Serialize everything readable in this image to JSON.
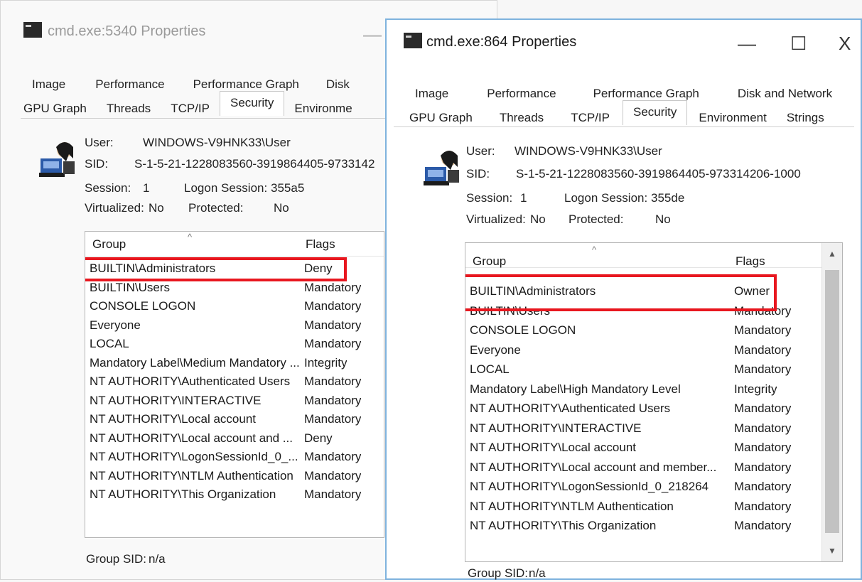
{
  "back_window": {
    "title": "cmd.exe:5340 Properties",
    "tabs_row1": [
      "Image",
      "Performance",
      "Performance Graph",
      "Disk"
    ],
    "tabs_row2": [
      "GPU Graph",
      "Threads",
      "TCP/IP",
      "Security",
      "Environme"
    ],
    "user_label": "User:",
    "user_value": "WINDOWS-V9HNK33\\User",
    "sid_label": "SID:",
    "sid_value": "S-1-5-21-1228083560-3919864405-9733142",
    "session_label": "Session:",
    "session_value": "1",
    "logon_label": "Logon Session:",
    "logon_value": "355a5",
    "virtualized_label": "Virtualized:",
    "virtualized_value": "No",
    "protected_label": "Protected:",
    "protected_value": "No",
    "list_headers": {
      "group": "Group",
      "flags": "Flags"
    },
    "rows": [
      {
        "group": "BUILTIN\\Administrators",
        "flags": "Deny"
      },
      {
        "group": "BUILTIN\\Users",
        "flags": "Mandatory"
      },
      {
        "group": "CONSOLE LOGON",
        "flags": "Mandatory"
      },
      {
        "group": "Everyone",
        "flags": "Mandatory"
      },
      {
        "group": "LOCAL",
        "flags": "Mandatory"
      },
      {
        "group": "Mandatory Label\\Medium Mandatory ...",
        "flags": "Integrity"
      },
      {
        "group": "NT AUTHORITY\\Authenticated Users",
        "flags": "Mandatory"
      },
      {
        "group": "NT AUTHORITY\\INTERACTIVE",
        "flags": "Mandatory"
      },
      {
        "group": "NT AUTHORITY\\Local account",
        "flags": "Mandatory"
      },
      {
        "group": "NT AUTHORITY\\Local account and ...",
        "flags": "Deny"
      },
      {
        "group": "NT AUTHORITY\\LogonSessionId_0_...",
        "flags": "Mandatory"
      },
      {
        "group": "NT AUTHORITY\\NTLM Authentication",
        "flags": "Mandatory"
      },
      {
        "group": "NT AUTHORITY\\This Organization",
        "flags": "Mandatory"
      }
    ],
    "group_sid_label": "Group SID:",
    "group_sid_value": "n/a"
  },
  "front_window": {
    "title": "cmd.exe:864 Properties",
    "controls": {
      "minimize": "—",
      "maximize": "☐",
      "close": "X"
    },
    "tabs_row1": [
      "Image",
      "Performance",
      "Performance Graph",
      "Disk and Network"
    ],
    "tabs_row2": [
      "GPU Graph",
      "Threads",
      "TCP/IP",
      "Security",
      "Environment",
      "Strings"
    ],
    "user_label": "User:",
    "user_value": "WINDOWS-V9HNK33\\User",
    "sid_label": "SID:",
    "sid_value": "S-1-5-21-1228083560-3919864405-973314206-1000",
    "session_label": "Session:",
    "session_value": "1",
    "logon_label": "Logon Session:",
    "logon_value": "355de",
    "virtualized_label": "Virtualized:",
    "virtualized_value": "No",
    "protected_label": "Protected:",
    "protected_value": "No",
    "list_headers": {
      "group": "Group",
      "flags": "Flags"
    },
    "rows": [
      {
        "group": "BUILTIN\\Administrators",
        "flags": "Owner"
      },
      {
        "group": "BUILTIN\\Users",
        "flags": "Mandatory"
      },
      {
        "group": "CONSOLE LOGON",
        "flags": "Mandatory"
      },
      {
        "group": "Everyone",
        "flags": "Mandatory"
      },
      {
        "group": "LOCAL",
        "flags": "Mandatory"
      },
      {
        "group": "Mandatory Label\\High Mandatory Level",
        "flags": "Integrity"
      },
      {
        "group": "NT AUTHORITY\\Authenticated Users",
        "flags": "Mandatory"
      },
      {
        "group": "NT AUTHORITY\\INTERACTIVE",
        "flags": "Mandatory"
      },
      {
        "group": "NT AUTHORITY\\Local account",
        "flags": "Mandatory"
      },
      {
        "group": "NT AUTHORITY\\Local account and member...",
        "flags": "Mandatory"
      },
      {
        "group": "NT AUTHORITY\\LogonSessionId_0_218264",
        "flags": "Mandatory"
      },
      {
        "group": "NT AUTHORITY\\NTLM Authentication",
        "flags": "Mandatory"
      },
      {
        "group": "NT AUTHORITY\\This Organization",
        "flags": "Mandatory"
      }
    ],
    "group_sid_label": "Group SID:",
    "group_sid_value": "n/a"
  },
  "icons": [
    "console-app-icon",
    "user-icon",
    "sort-up-icon",
    "scroll-up-icon",
    "scroll-down-icon"
  ],
  "colors": {
    "highlight": "#e8171f",
    "active_window_border": "#7fb3de"
  }
}
